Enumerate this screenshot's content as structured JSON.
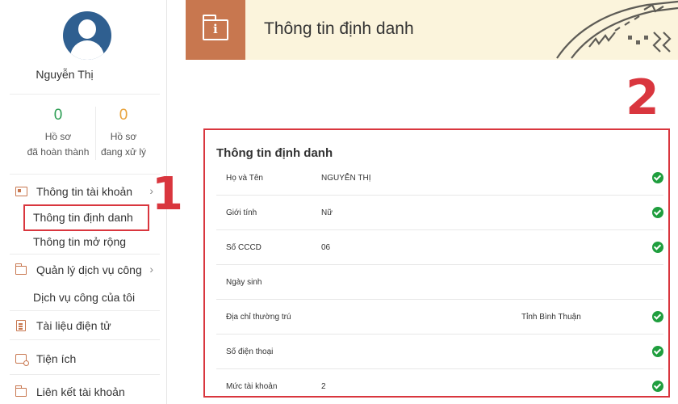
{
  "user": {
    "name": "Nguyễn Thị"
  },
  "stats": [
    {
      "count": "0",
      "line1": "Hồ sơ",
      "line2": "đã hoàn thành",
      "color": "#2e9e55"
    },
    {
      "count": "0",
      "line1": "Hồ sơ",
      "line2": "đang xử lý",
      "color": "#e8a33d"
    }
  ],
  "sidebar": {
    "account_info": "Thông tin tài khoản",
    "identity_info": "Thông tin định danh",
    "extended_info": "Thông tin mở rộng",
    "manage_services": "Quản lý dịch vụ công",
    "my_services": "Dịch vụ công của tôi",
    "e_documents": "Tài liệu điện tử",
    "utilities": "Tiện ích",
    "linked_accounts": "Liên kết tài khoản"
  },
  "annotations": {
    "one": "1",
    "two": "2"
  },
  "header": {
    "title": "Thông tin định danh"
  },
  "panel": {
    "title": "Thông tin định danh",
    "rows": [
      {
        "label": "Họ và Tên",
        "value": "NGUYỄN THỊ",
        "value_right": "",
        "verified": true
      },
      {
        "label": "Giới tính",
        "value": "Nữ",
        "value_right": "",
        "verified": true
      },
      {
        "label": "Số CCCD",
        "value": "06",
        "value_right": "",
        "verified": true
      },
      {
        "label": "Ngày sinh",
        "value": "",
        "value_right": "",
        "verified": false
      },
      {
        "label": "Địa chỉ thường trú",
        "value": "",
        "value_right": "Tỉnh Bình Thuận",
        "verified": true
      },
      {
        "label": "Số điện thoại",
        "value": "",
        "value_right": "",
        "verified": true
      },
      {
        "label": "Mức tài khoản",
        "value": "2",
        "value_right": "",
        "verified": true
      }
    ]
  },
  "colors": {
    "accent": "#c8774f",
    "highlight": "#d9363e",
    "check": "#1f9e3e",
    "banner": "#fbf4dc"
  }
}
